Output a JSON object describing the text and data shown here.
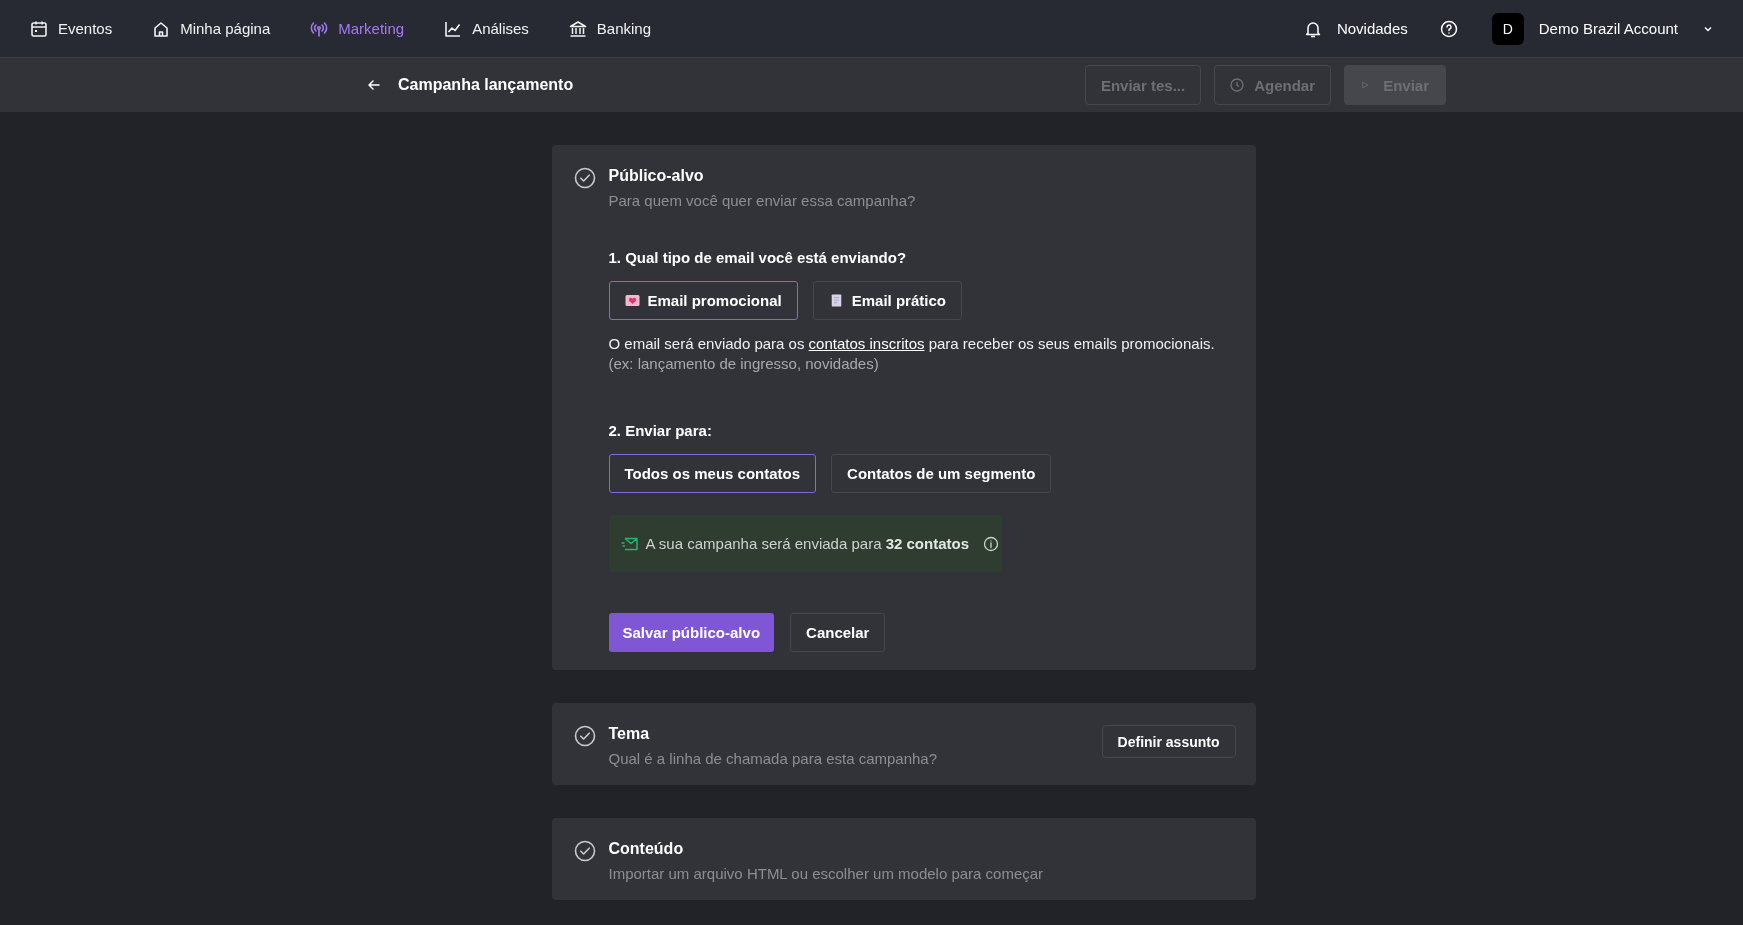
{
  "nav": {
    "items": [
      {
        "label": "Eventos",
        "selected": false
      },
      {
        "label": "Minha página",
        "selected": false
      },
      {
        "label": "Marketing",
        "selected": true
      },
      {
        "label": "Análises",
        "selected": false
      },
      {
        "label": "Banking",
        "selected": false
      }
    ],
    "news": "Novidades",
    "account": {
      "initial": "D",
      "name": "Demo Brazil Account"
    }
  },
  "header": {
    "title": "Campanha lançamento",
    "actions": [
      {
        "label": "Enviar tes...",
        "kind": "outline",
        "disabled": true
      },
      {
        "label": "Agendar",
        "kind": "schedule",
        "disabled": true
      },
      {
        "label": "Enviar",
        "kind": "send",
        "disabled": true
      }
    ]
  },
  "sections": [
    {
      "title": "Público-alvo",
      "subtitle": "Para quem você quer enviar essa campanha?",
      "expanded": true,
      "question_1": "1. Qual tipo de email você está enviando?",
      "email_types": [
        {
          "label": "Email promocional",
          "kind": "promo",
          "selected": true
        },
        {
          "label": "Email prático",
          "kind": "practical",
          "selected": false
        }
      ],
      "description": {
        "before": "O email será enviado para os ",
        "link": "contatos inscritos",
        "after": " para receber os seus emails promocionais."
      },
      "example": "(ex: lançamento de ingresso, novidades)",
      "question_2": "2. Enviar para:",
      "recipients": [
        {
          "label": "Todos os meus contatos",
          "selected": true
        },
        {
          "label": "Contatos de um segmento",
          "selected": false
        }
      ],
      "summary": "A sua campanha será enviada para **32 contatos**",
      "save": "Salvar público-alvo",
      "cancel": "Cancelar"
    },
    {
      "title": "Tema",
      "subtitle": "Qual é a linha de chamada para esta campanha?",
      "expanded": false,
      "action": "Definir assunto"
    },
    {
      "title": "Conteúdo",
      "subtitle": "Importar um arquivo HTML ou escolher um modelo para começar",
      "expanded": false
    }
  ]
}
